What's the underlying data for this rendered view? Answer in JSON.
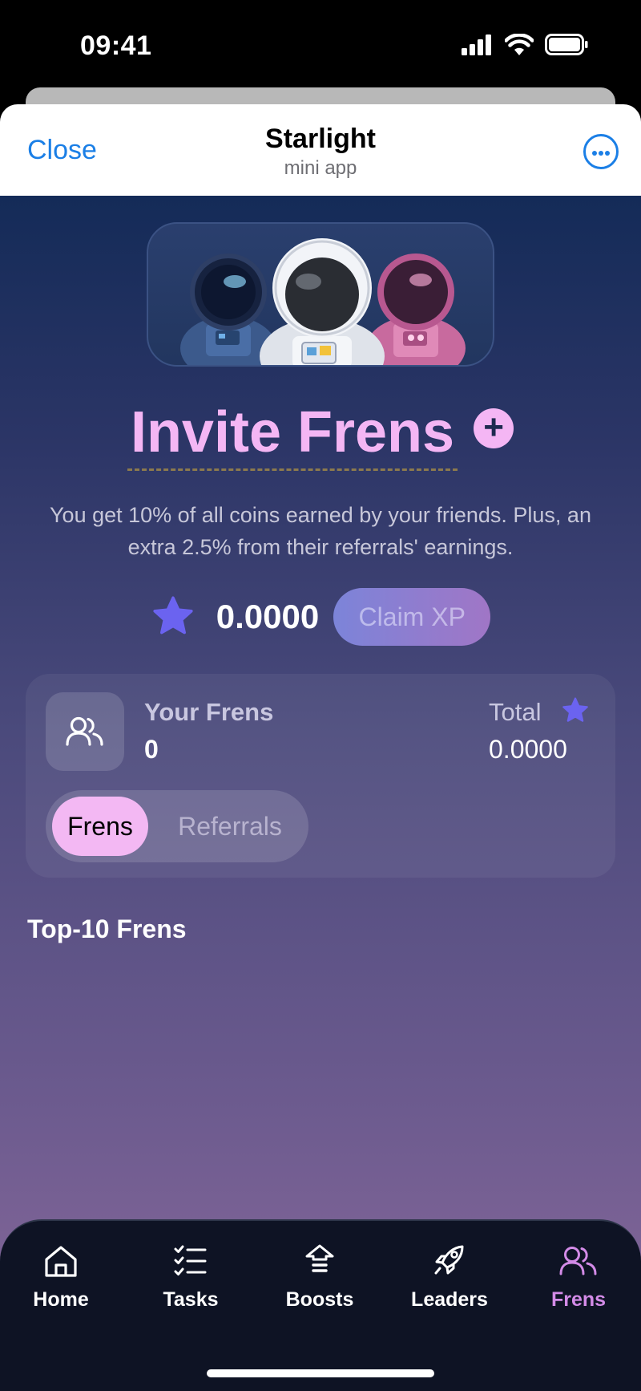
{
  "status_bar": {
    "time": "09:41",
    "icons": [
      "signal-icon",
      "wifi-icon",
      "battery-icon"
    ]
  },
  "header": {
    "close_label": "Close",
    "title": "Starlight",
    "subtitle": "mini app",
    "more_icon": "more-icon"
  },
  "hero": {
    "image": "astronauts-illustration"
  },
  "invite": {
    "title": "Invite Frens",
    "description": "You get 10% of all coins earned by your friends. Plus, an extra 2.5% from their referrals' earnings."
  },
  "xp": {
    "amount": "0.0000",
    "claim_label": "Claim XP"
  },
  "frens_card": {
    "your_frens_label": "Your Frens",
    "your_frens_count": "0",
    "total_label": "Total",
    "total_value": "0.0000",
    "tabs": [
      {
        "label": "Frens",
        "active": true
      },
      {
        "label": "Referrals",
        "active": false
      }
    ]
  },
  "top_list": {
    "title": "Top-10 Frens"
  },
  "bottom_nav": {
    "items": [
      {
        "label": "Home",
        "icon": "home-icon"
      },
      {
        "label": "Tasks",
        "icon": "tasks-icon"
      },
      {
        "label": "Boosts",
        "icon": "boosts-icon"
      },
      {
        "label": "Leaders",
        "icon": "rocket-icon"
      },
      {
        "label": "Frens",
        "icon": "users-icon",
        "active": true
      }
    ]
  },
  "colors": {
    "accent_pink": "#f4b6f4",
    "link_blue": "#1b7fe6",
    "star_purple": "#6b63f0",
    "nav_active": "#d38be7"
  }
}
